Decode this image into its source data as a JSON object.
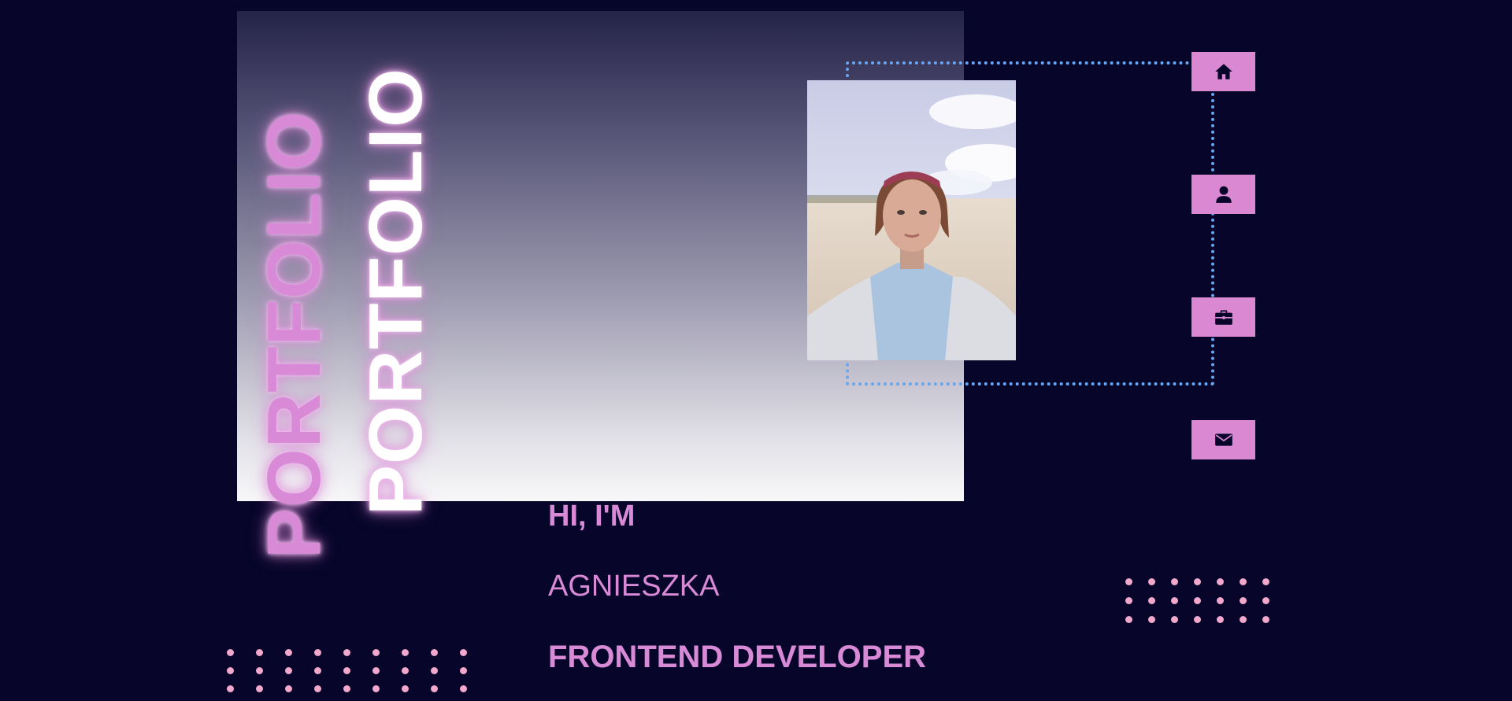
{
  "hero": {
    "title_outline": "PORTFOLIO",
    "title_solid": "PORTFOLIO",
    "greeting": "HI, I'M",
    "name": "AGNIESZKA",
    "role": "FRONTEND DEVELOPER"
  },
  "nav": {
    "items": [
      {
        "icon": "home-icon"
      },
      {
        "icon": "user-icon"
      },
      {
        "icon": "briefcase-icon"
      },
      {
        "icon": "envelope-icon"
      }
    ]
  },
  "colors": {
    "background": "#07052a",
    "accent_pink": "#db88d3",
    "frame_blue": "#6aa6ee",
    "dots": "#f2a7cc"
  }
}
